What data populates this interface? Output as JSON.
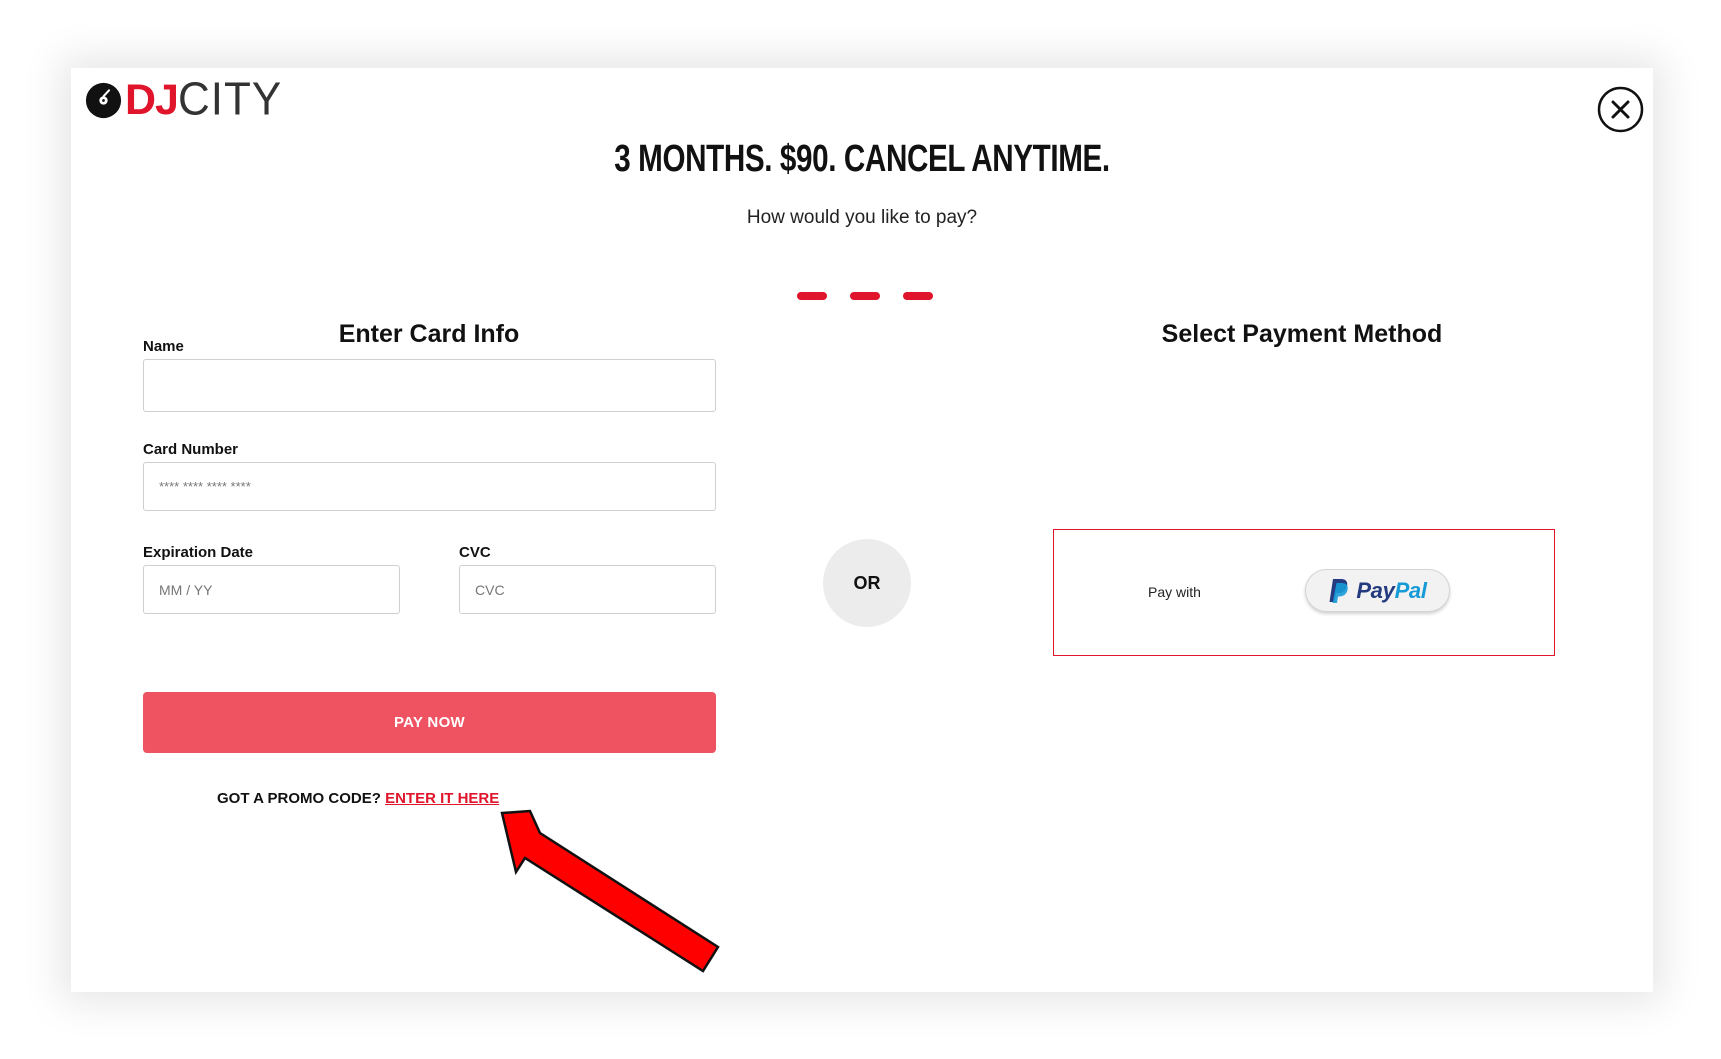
{
  "logo": {
    "brand_dj": "DJ",
    "brand_city": "CITY",
    "icon": "vinyl-disc-icon",
    "brand_color": "#e0142a"
  },
  "close_icon": "close-icon",
  "headline": "3 MONTHS. $90. CANCEL ANYTIME.",
  "subhead": "How would you like to pay?",
  "step_dashes": 3,
  "card_section": {
    "title": "Enter Card Info",
    "name_label": "Name",
    "name_value": "",
    "card_number_label": "Card Number",
    "card_number_placeholder": "**** **** **** ****",
    "expiration_label": "Expiration Date",
    "expiration_placeholder": "MM / YY",
    "cvc_label": "CVC",
    "cvc_placeholder": "CVC",
    "pay_button": "PAY NOW",
    "pay_button_color": "#ef5362",
    "promo_text": "GOT A PROMO CODE?",
    "promo_link": "ENTER IT HERE"
  },
  "divider": {
    "label": "OR"
  },
  "method_section": {
    "title": "Select Payment Method",
    "pay_with": "Pay with",
    "paypal_pay": "Pay",
    "paypal_pal": "Pal",
    "paypal_icon": "paypal-p-icon",
    "paypal_colors": {
      "dark": "#253b80",
      "light": "#179bd7"
    },
    "selected_border_color": "#e0142a"
  },
  "annotation": {
    "icon": "red-arrow-icon",
    "color": "#ff0000"
  }
}
